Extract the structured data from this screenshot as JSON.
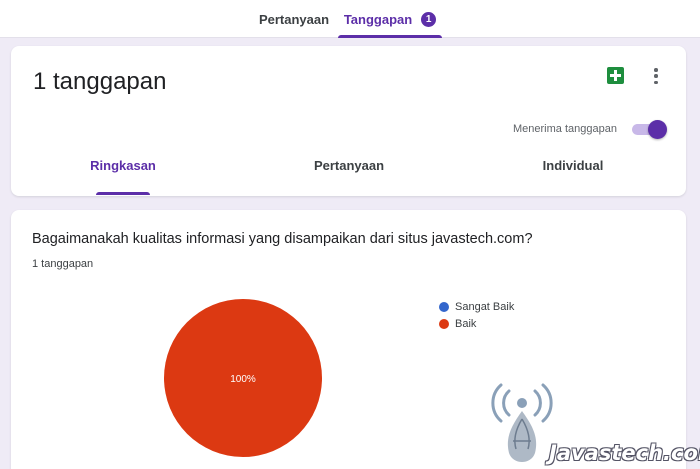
{
  "top_tabs": {
    "questions_label": "Pertanyaan",
    "responses_label": "Tanggapan",
    "responses_badge": "1"
  },
  "summary_card": {
    "response_count_title": "1 tanggapan",
    "accepting_label": "Menerima tanggapan",
    "accepting_on": true,
    "icons": [
      "sheets-icon",
      "more-vert-icon"
    ],
    "sub_tabs": [
      "Ringkasan",
      "Pertanyaan",
      "Individual"
    ],
    "active_sub_tab": "Ringkasan"
  },
  "question_card": {
    "question": "Bagaimanakah kualitas informasi yang disampaikan dari situs javastech.com?",
    "response_count": "1 tanggapan"
  },
  "chart_data": {
    "type": "pie",
    "categories": [
      "Sangat Baik",
      "Baik"
    ],
    "values": [
      0,
      100
    ],
    "colors": [
      "#3366cc",
      "#dc3912"
    ],
    "slice_labels": [
      "",
      "100%"
    ],
    "legend_position": "right"
  },
  "watermark": {
    "text": "Javastech.com"
  },
  "colors": {
    "accent": "#5c2ea8",
    "sheets_green": "#1e8e3e",
    "background": "#efebf6"
  }
}
